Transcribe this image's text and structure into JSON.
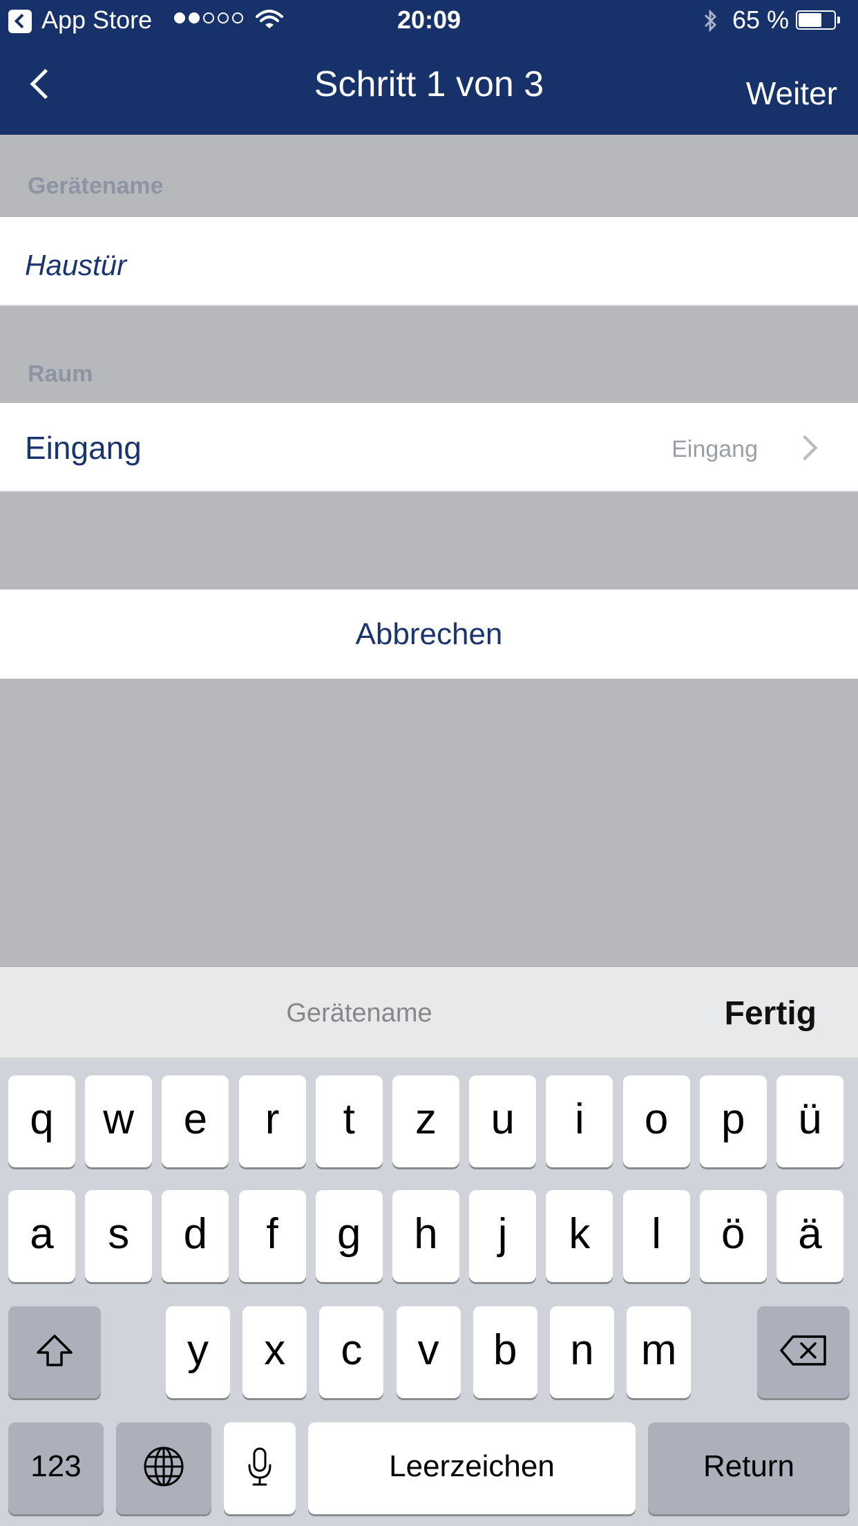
{
  "status_bar": {
    "back_app": "App Store",
    "signal_dots": [
      true,
      true,
      false,
      false,
      false
    ],
    "time": "20:09",
    "battery": "65 %",
    "battery_level": 0.65
  },
  "nav": {
    "back_icon": "chevron-left-icon",
    "title": "Schritt 1 von 3",
    "next": "Weiter"
  },
  "form": {
    "name_header": "Gerätename",
    "name_value": "Haustür",
    "room_header": "Raum",
    "room_title": "Eingang",
    "room_value": "Eingang",
    "cancel": "Abbrechen"
  },
  "keyboard": {
    "toolbar_field": "Gerätename",
    "toolbar_done": "Fertig",
    "row1": [
      "q",
      "w",
      "e",
      "r",
      "t",
      "z",
      "u",
      "i",
      "o",
      "p",
      "ü"
    ],
    "row2": [
      "a",
      "s",
      "d",
      "f",
      "g",
      "h",
      "j",
      "k",
      "l",
      "ö",
      "ä"
    ],
    "row3": [
      "y",
      "x",
      "c",
      "v",
      "b",
      "n",
      "m"
    ],
    "numbers": "123",
    "space": "Leerzeichen",
    "return": "Return"
  },
  "colors": {
    "nav_bg": "#17326b",
    "accent_text": "#1a3470",
    "page_bg": "#b7b8bc"
  }
}
